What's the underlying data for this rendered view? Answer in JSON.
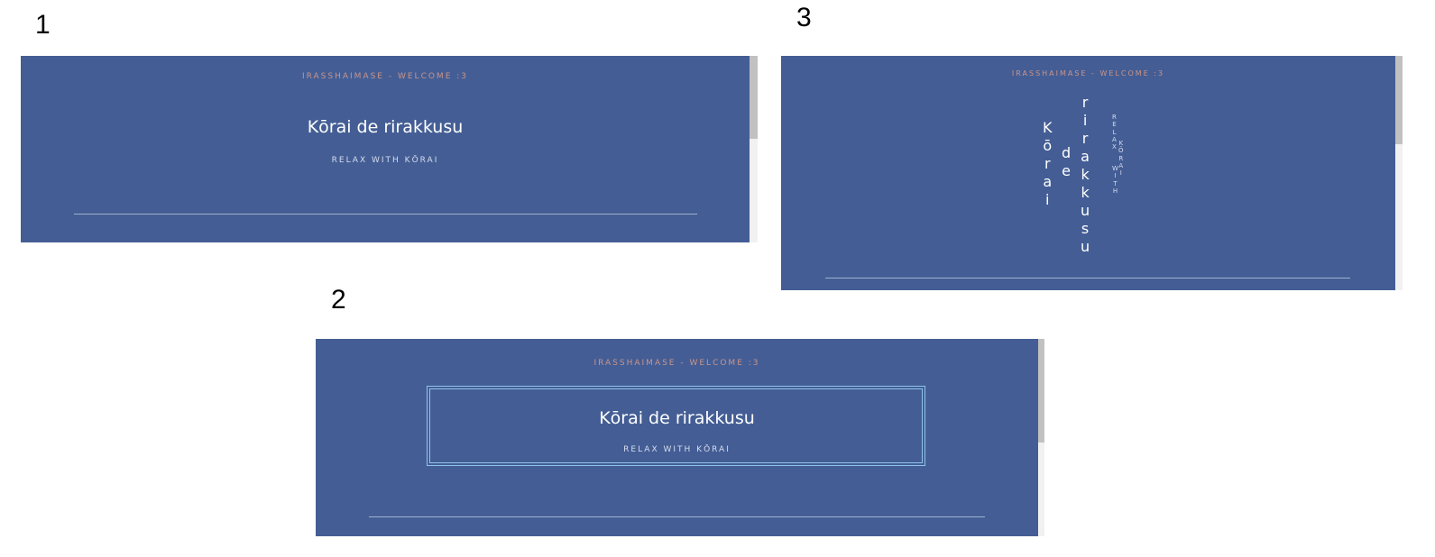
{
  "figure_numbers": [
    "1",
    "2",
    "3"
  ],
  "colors": {
    "panel_background": "#445e95",
    "welcome_text": "#c8948a",
    "title_text": "#ffffff",
    "subtitle_text": "#d6dced",
    "divider": "#9fb0cf",
    "title_border": "#8fc3eb",
    "scrollbar_thumb": "#c1c1c1",
    "scrollbar_track": "#f1f1f1"
  },
  "panels": [
    {
      "welcome": "IRASSHAIMASE - WELCOME :3",
      "title": "Kōrai de rirakkusu",
      "subtitle": "RELAX WITH KŌRAI"
    },
    {
      "welcome": "IRASSHAIMASE - WELCOME :3",
      "title": "Kōrai de rirakkusu",
      "subtitle": "RELAX WITH KŌRAI"
    },
    {
      "welcome": "IRASSHAIMASE - WELCOME :3",
      "title_words": [
        "Kōrai",
        "de",
        "rirakkusu"
      ],
      "subtitle_words": [
        "RELAX",
        "WITH",
        "KŌRAI"
      ]
    }
  ]
}
